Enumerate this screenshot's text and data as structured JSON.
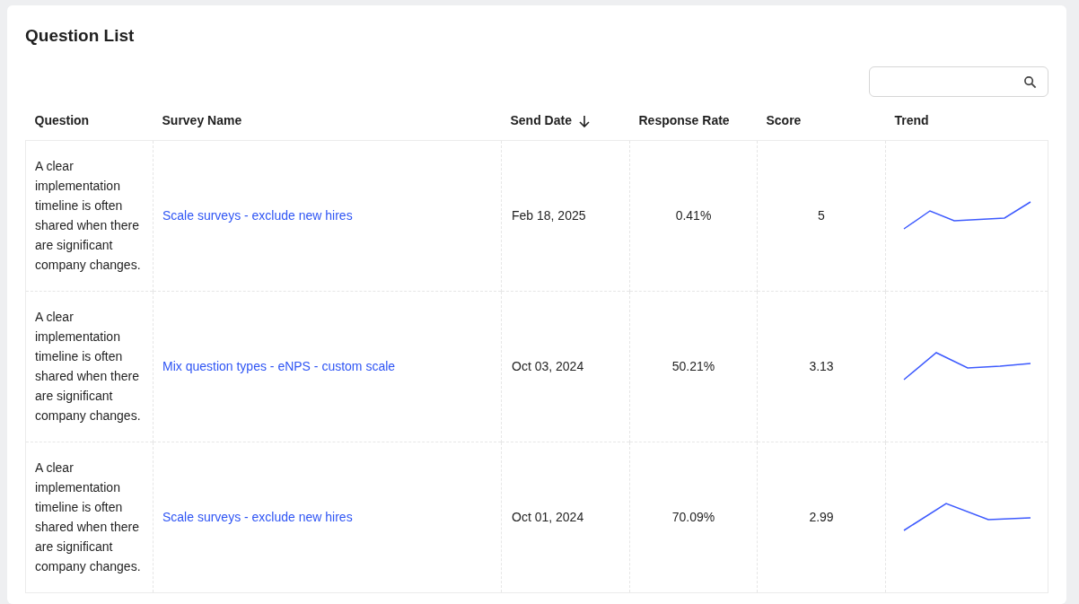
{
  "title": "Question List",
  "table": {
    "columns": [
      {
        "label": "Question",
        "sorted": false
      },
      {
        "label": "Survey Name",
        "sorted": false
      },
      {
        "label": "Send Date",
        "sorted": true
      },
      {
        "label": "Response Rate",
        "sorted": false
      },
      {
        "label": "Score",
        "sorted": false
      },
      {
        "label": "Trend",
        "sorted": false
      }
    ],
    "rows": [
      {
        "question": "A clear implementation timeline is often shared when there are significant company changes.",
        "survey_name": "Scale surveys - exclude new hires",
        "send_date": "Feb 18, 2025",
        "response_rate": "0.41%",
        "score": "5"
      },
      {
        "question": "A clear implementation timeline is often shared when there are significant company changes.",
        "survey_name": "Mix question types - eNPS - custom scale",
        "send_date": "Oct 03, 2024",
        "response_rate": "50.21%",
        "score": "3.13"
      },
      {
        "question": "A clear implementation timeline is often shared when there are significant company changes.",
        "survey_name": "Scale surveys - exclude new hires",
        "send_date": "Oct 01, 2024",
        "response_rate": "70.09%",
        "score": "2.99"
      }
    ]
  }
}
